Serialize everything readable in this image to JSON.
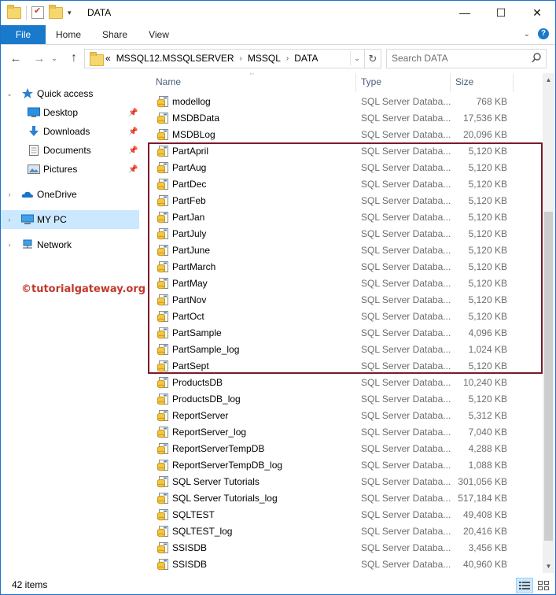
{
  "window": {
    "title": "DATA",
    "quick_access_dropdown": "▾",
    "minimize": "—",
    "maximize": "☐",
    "close": "✕"
  },
  "ribbon": {
    "tabs": [
      "File",
      "Home",
      "Share",
      "View"
    ],
    "help": "?"
  },
  "address": {
    "overflow": "«",
    "crumbs": [
      "MSSQL12.MSSQLSERVER",
      "MSSQL",
      "DATA"
    ],
    "search_placeholder": "Search DATA"
  },
  "nav_pane": {
    "items": [
      {
        "label": "Quick access",
        "icon": "star-icon",
        "expander": "expanded"
      },
      {
        "label": "Desktop",
        "icon": "desktop-icon",
        "pinned": true
      },
      {
        "label": "Downloads",
        "icon": "download-icon",
        "pinned": true
      },
      {
        "label": "Documents",
        "icon": "document-icon",
        "pinned": true
      },
      {
        "label": "Pictures",
        "icon": "picture-icon",
        "pinned": true
      },
      {
        "label": "OneDrive",
        "icon": "cloud-icon",
        "expander": "collapsed"
      },
      {
        "label": "MY PC",
        "icon": "computer-icon",
        "expander": "collapsed",
        "selected": true
      },
      {
        "label": "Network",
        "icon": "network-icon",
        "expander": "collapsed"
      }
    ],
    "watermark": "©tutorialgateway.org"
  },
  "file_list": {
    "columns": {
      "name": "Name",
      "type": "Type",
      "size": "Size"
    },
    "files": [
      {
        "name": "modellog",
        "type": "SQL Server Databa...",
        "size": "768 KB"
      },
      {
        "name": "MSDBData",
        "type": "SQL Server Databa...",
        "size": "17,536 KB"
      },
      {
        "name": "MSDBLog",
        "type": "SQL Server Databa...",
        "size": "20,096 KB"
      },
      {
        "name": "PartApril",
        "type": "SQL Server Databa...",
        "size": "5,120 KB"
      },
      {
        "name": "PartAug",
        "type": "SQL Server Databa...",
        "size": "5,120 KB"
      },
      {
        "name": "PartDec",
        "type": "SQL Server Databa...",
        "size": "5,120 KB"
      },
      {
        "name": "PartFeb",
        "type": "SQL Server Databa...",
        "size": "5,120 KB"
      },
      {
        "name": "PartJan",
        "type": "SQL Server Databa...",
        "size": "5,120 KB"
      },
      {
        "name": "PartJuly",
        "type": "SQL Server Databa...",
        "size": "5,120 KB"
      },
      {
        "name": "PartJune",
        "type": "SQL Server Databa...",
        "size": "5,120 KB"
      },
      {
        "name": "PartMarch",
        "type": "SQL Server Databa...",
        "size": "5,120 KB"
      },
      {
        "name": "PartMay",
        "type": "SQL Server Databa...",
        "size": "5,120 KB"
      },
      {
        "name": "PartNov",
        "type": "SQL Server Databa...",
        "size": "5,120 KB"
      },
      {
        "name": "PartOct",
        "type": "SQL Server Databa...",
        "size": "5,120 KB"
      },
      {
        "name": "PartSample",
        "type": "SQL Server Databa...",
        "size": "4,096 KB"
      },
      {
        "name": "PartSample_log",
        "type": "SQL Server Databa...",
        "size": "1,024 KB"
      },
      {
        "name": "PartSept",
        "type": "SQL Server Databa...",
        "size": "5,120 KB"
      },
      {
        "name": "ProductsDB",
        "type": "SQL Server Databa...",
        "size": "10,240 KB"
      },
      {
        "name": "ProductsDB_log",
        "type": "SQL Server Databa...",
        "size": "5,120 KB"
      },
      {
        "name": "ReportServer",
        "type": "SQL Server Databa...",
        "size": "5,312 KB"
      },
      {
        "name": "ReportServer_log",
        "type": "SQL Server Databa...",
        "size": "7,040 KB"
      },
      {
        "name": "ReportServerTempDB",
        "type": "SQL Server Databa...",
        "size": "4,288 KB"
      },
      {
        "name": "ReportServerTempDB_log",
        "type": "SQL Server Databa...",
        "size": "1,088 KB"
      },
      {
        "name": "SQL Server Tutorials",
        "type": "SQL Server Databa...",
        "size": "301,056 KB"
      },
      {
        "name": "SQL Server Tutorials_log",
        "type": "SQL Server Databa...",
        "size": "517,184 KB"
      },
      {
        "name": "SQLTEST",
        "type": "SQL Server Databa...",
        "size": "49,408 KB"
      },
      {
        "name": "SQLTEST_log",
        "type": "SQL Server Databa...",
        "size": "20,416 KB"
      },
      {
        "name": "SSISDB",
        "type": "SQL Server Databa...",
        "size": "3,456 KB"
      },
      {
        "name": "SSISDB",
        "type": "SQL Server Databa...",
        "size": "40,960 KB"
      }
    ]
  },
  "status": {
    "item_count": "42 items"
  },
  "colors": {
    "accent": "#1979ca",
    "selection": "#cce8ff",
    "highlight_box": "#7a1b2b",
    "watermark": "#c0392b"
  }
}
